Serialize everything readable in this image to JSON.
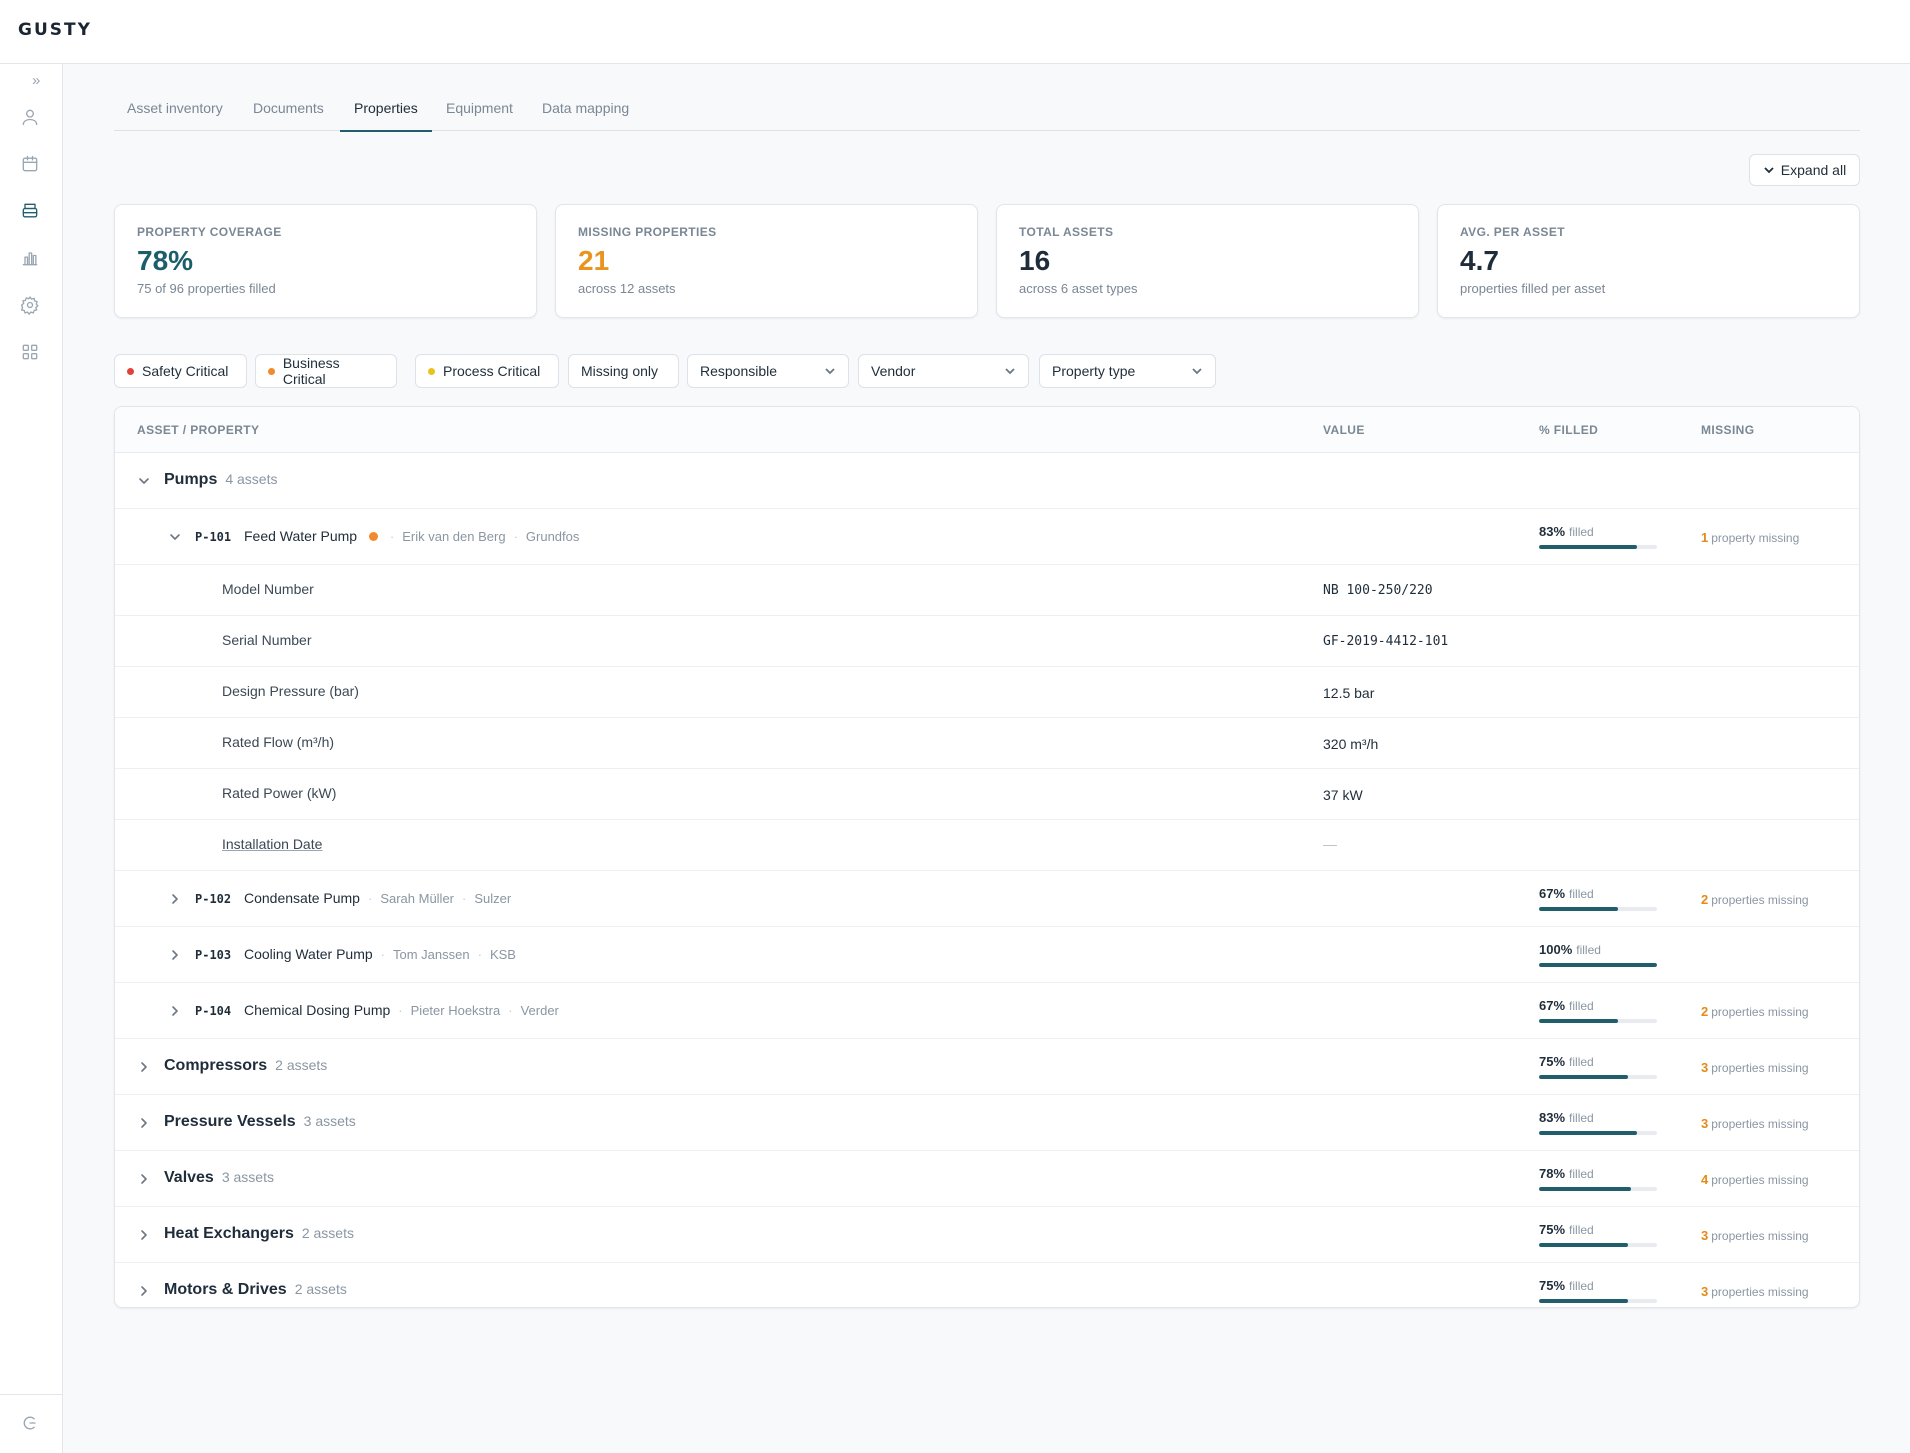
{
  "app": {
    "logo": "GUSTY"
  },
  "sidebar": {
    "expand_glyph": "»",
    "icons": [
      "user-icon",
      "calendar-icon",
      "layers-icon",
      "bar-chart-icon",
      "gear-icon",
      "grid-icon"
    ],
    "active_icon": "layers-icon",
    "bottom_icon": "logo-mark-icon"
  },
  "tabs": [
    "Asset inventory",
    "Documents",
    "Properties",
    "Equipment",
    "Data mapping"
  ],
  "active_tab": "Properties",
  "expand_all_label": "Expand all",
  "kpis": [
    {
      "label": "PROPERTY COVERAGE",
      "value": "78%",
      "sub": "75 of 96 properties filled",
      "color": "#1b5e6a"
    },
    {
      "label": "MISSING PROPERTIES",
      "value": "21",
      "sub": "across 12 assets",
      "color": "#e8941e"
    },
    {
      "label": "TOTAL ASSETS",
      "value": "16",
      "sub": "across 6 asset types",
      "color": "#1f2d3a"
    },
    {
      "label": "AVG. PER ASSET",
      "value": "4.7",
      "sub": "properties filled per asset",
      "color": "#1f2d3a"
    }
  ],
  "filters": {
    "safety": {
      "label": "Safety Critical",
      "color": "#e0413b"
    },
    "business": {
      "label": "Business Critical",
      "color": "#f08a2c"
    },
    "process": {
      "label": "Process Critical",
      "color": "#e9c21e"
    },
    "missing_only": "Missing only",
    "responsible": "Responsible",
    "vendor": "Vendor",
    "property_type": "Property type"
  },
  "table": {
    "headers": {
      "asset": "ASSET / PROPERTY",
      "value": "VALUE",
      "filled": "% FILLED",
      "missing": "MISSING"
    },
    "pumps": {
      "name": "Pumps",
      "count": "4 assets"
    },
    "p101": {
      "id": "P-101",
      "name": "Feed Water Pump",
      "criticality_color": "#f08a2c",
      "responsible": "Erik van den Berg",
      "vendor": "Grundfos",
      "pct": "83%",
      "filled_word": "filled",
      "fill": 0.83,
      "missing_n": "1",
      "missing_text": "property missing",
      "properties": [
        {
          "name": "Model Number",
          "value": "NB 100-250/220"
        },
        {
          "name": "Serial Number",
          "value": "GF-2019-4412-101"
        },
        {
          "name": "Design Pressure (bar)",
          "value": "12.5 bar"
        },
        {
          "name": "Rated Flow (m³/h)",
          "value": "320 m³/h"
        },
        {
          "name": "Rated Power (kW)",
          "value": "37 kW"
        },
        {
          "name": "Installation Date",
          "value": "—"
        }
      ]
    },
    "p102": {
      "id": "P-102",
      "name": "Condensate Pump",
      "responsible": "Sarah Müller",
      "vendor": "Sulzer",
      "pct": "67%",
      "filled_word": "filled",
      "fill": 0.67,
      "missing_n": "2",
      "missing_text": "properties missing"
    },
    "p103": {
      "id": "P-103",
      "name": "Cooling Water Pump",
      "responsible": "Tom Janssen",
      "vendor": "KSB",
      "pct": "100%",
      "filled_word": "filled",
      "fill": 1.0
    },
    "p104": {
      "id": "P-104",
      "name": "Chemical Dosing Pump",
      "responsible": "Pieter Hoekstra",
      "vendor": "Verder",
      "pct": "67%",
      "filled_word": "filled",
      "fill": 0.67,
      "missing_n": "2",
      "missing_text": "properties missing"
    },
    "groups": [
      {
        "name": "Compressors",
        "count": "2 assets",
        "pct": "75%",
        "filled_word": "filled",
        "fill": 0.75,
        "missing_n": "3",
        "missing_text": "properties missing"
      },
      {
        "name": "Pressure Vessels",
        "count": "3 assets",
        "pct": "83%",
        "filled_word": "filled",
        "fill": 0.83,
        "missing_n": "3",
        "missing_text": "properties missing"
      },
      {
        "name": "Valves",
        "count": "3 assets",
        "pct": "78%",
        "filled_word": "filled",
        "fill": 0.78,
        "missing_n": "4",
        "missing_text": "properties missing"
      },
      {
        "name": "Heat Exchangers",
        "count": "2 assets",
        "pct": "75%",
        "filled_word": "filled",
        "fill": 0.75,
        "missing_n": "3",
        "missing_text": "properties missing"
      },
      {
        "name": "Motors & Drives",
        "count": "2 assets",
        "pct": "75%",
        "filled_word": "filled",
        "fill": 0.75,
        "missing_n": "3",
        "missing_text": "properties missing"
      }
    ]
  }
}
